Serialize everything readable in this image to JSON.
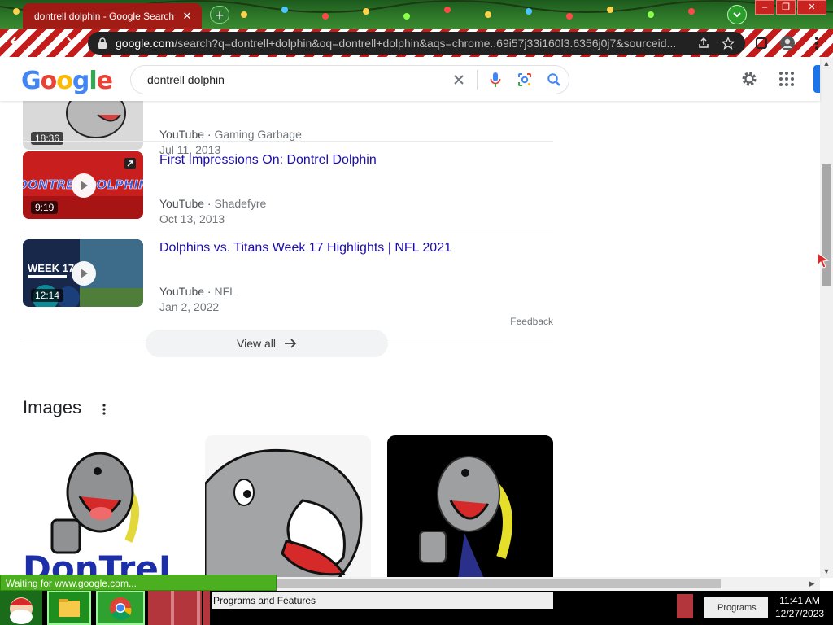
{
  "browser": {
    "tab_title": "dontrell dolphin - Google Search",
    "tab_close": "✕",
    "new_tab": "+",
    "url_host": "google.com",
    "url_rest": "/search?q=dontrell+dolphin&oq=dontrell+dolphin&aqs=chrome..69i57j33i160l3.6356j0j7&sourceid...",
    "window_controls": [
      "–",
      "❐",
      "✕"
    ]
  },
  "search": {
    "logo_letters": [
      "G",
      "o",
      "o",
      "g",
      "l",
      "e"
    ],
    "query": "dontrell dolphin"
  },
  "videos": [
    {
      "duration": "18:36",
      "title": "",
      "source": "YouTube",
      "channel": "Gaming Garbage",
      "date": "Jul 11, 2013"
    },
    {
      "duration": "9:19",
      "title": "First Impressions On: Dontrel Dolphin",
      "source": "YouTube",
      "channel": "Shadefyre",
      "date": "Oct 13, 2013"
    },
    {
      "duration": "12:14",
      "title": "Dolphins vs. Titans Week 17 Highlights | NFL 2021",
      "source": "YouTube",
      "channel": "NFL",
      "date": "Jan 2, 2022"
    }
  ],
  "thumb_texts": {
    "dontrel": "DONTREL DOLPHIN",
    "week": "WEEK 17"
  },
  "feedback": "Feedback",
  "view_all": "View all",
  "images_heading": "Images",
  "image_card_text": "DonTreL",
  "status_text": "Waiting for www.google.com...",
  "taskbar": {
    "window_label": "Programs and Features",
    "tray_label": "Programs",
    "time": "11:41 AM",
    "date": "12/27/2023"
  },
  "colors": {
    "link": "#1a0dab",
    "google_blue": "#4285f4",
    "google_red": "#ea4335",
    "google_yellow": "#fbbc05",
    "google_green": "#34a853",
    "status_green": "#4caf1f",
    "festive_red": "#c41b1b"
  }
}
